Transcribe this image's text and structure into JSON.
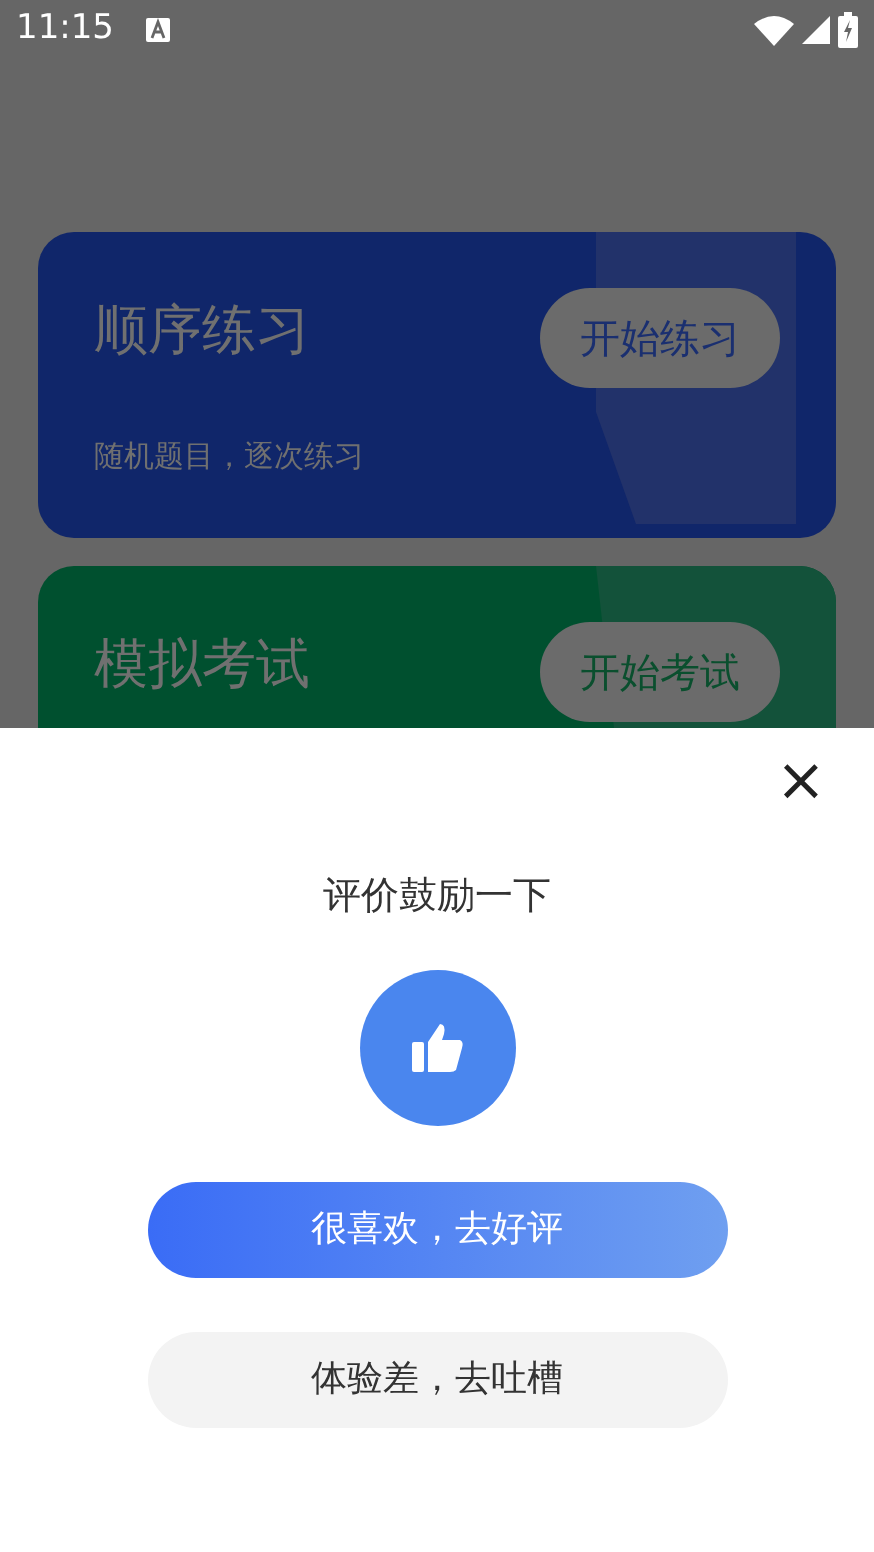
{
  "status_bar": {
    "time": "11:15"
  },
  "cards": [
    {
      "kind": "practice",
      "title": "顺序练习",
      "subtitle": "随机题目，逐次练习",
      "button": "开始练习"
    },
    {
      "kind": "exam",
      "title": "模拟考试",
      "button": "开始考试"
    }
  ],
  "rating_sheet": {
    "close": "×",
    "title": "评价鼓励一下",
    "buttons": [
      {
        "kind": "primary",
        "label": "很喜欢，去好评"
      },
      {
        "kind": "secondary",
        "label": "体验差，去吐槽"
      }
    ]
  }
}
